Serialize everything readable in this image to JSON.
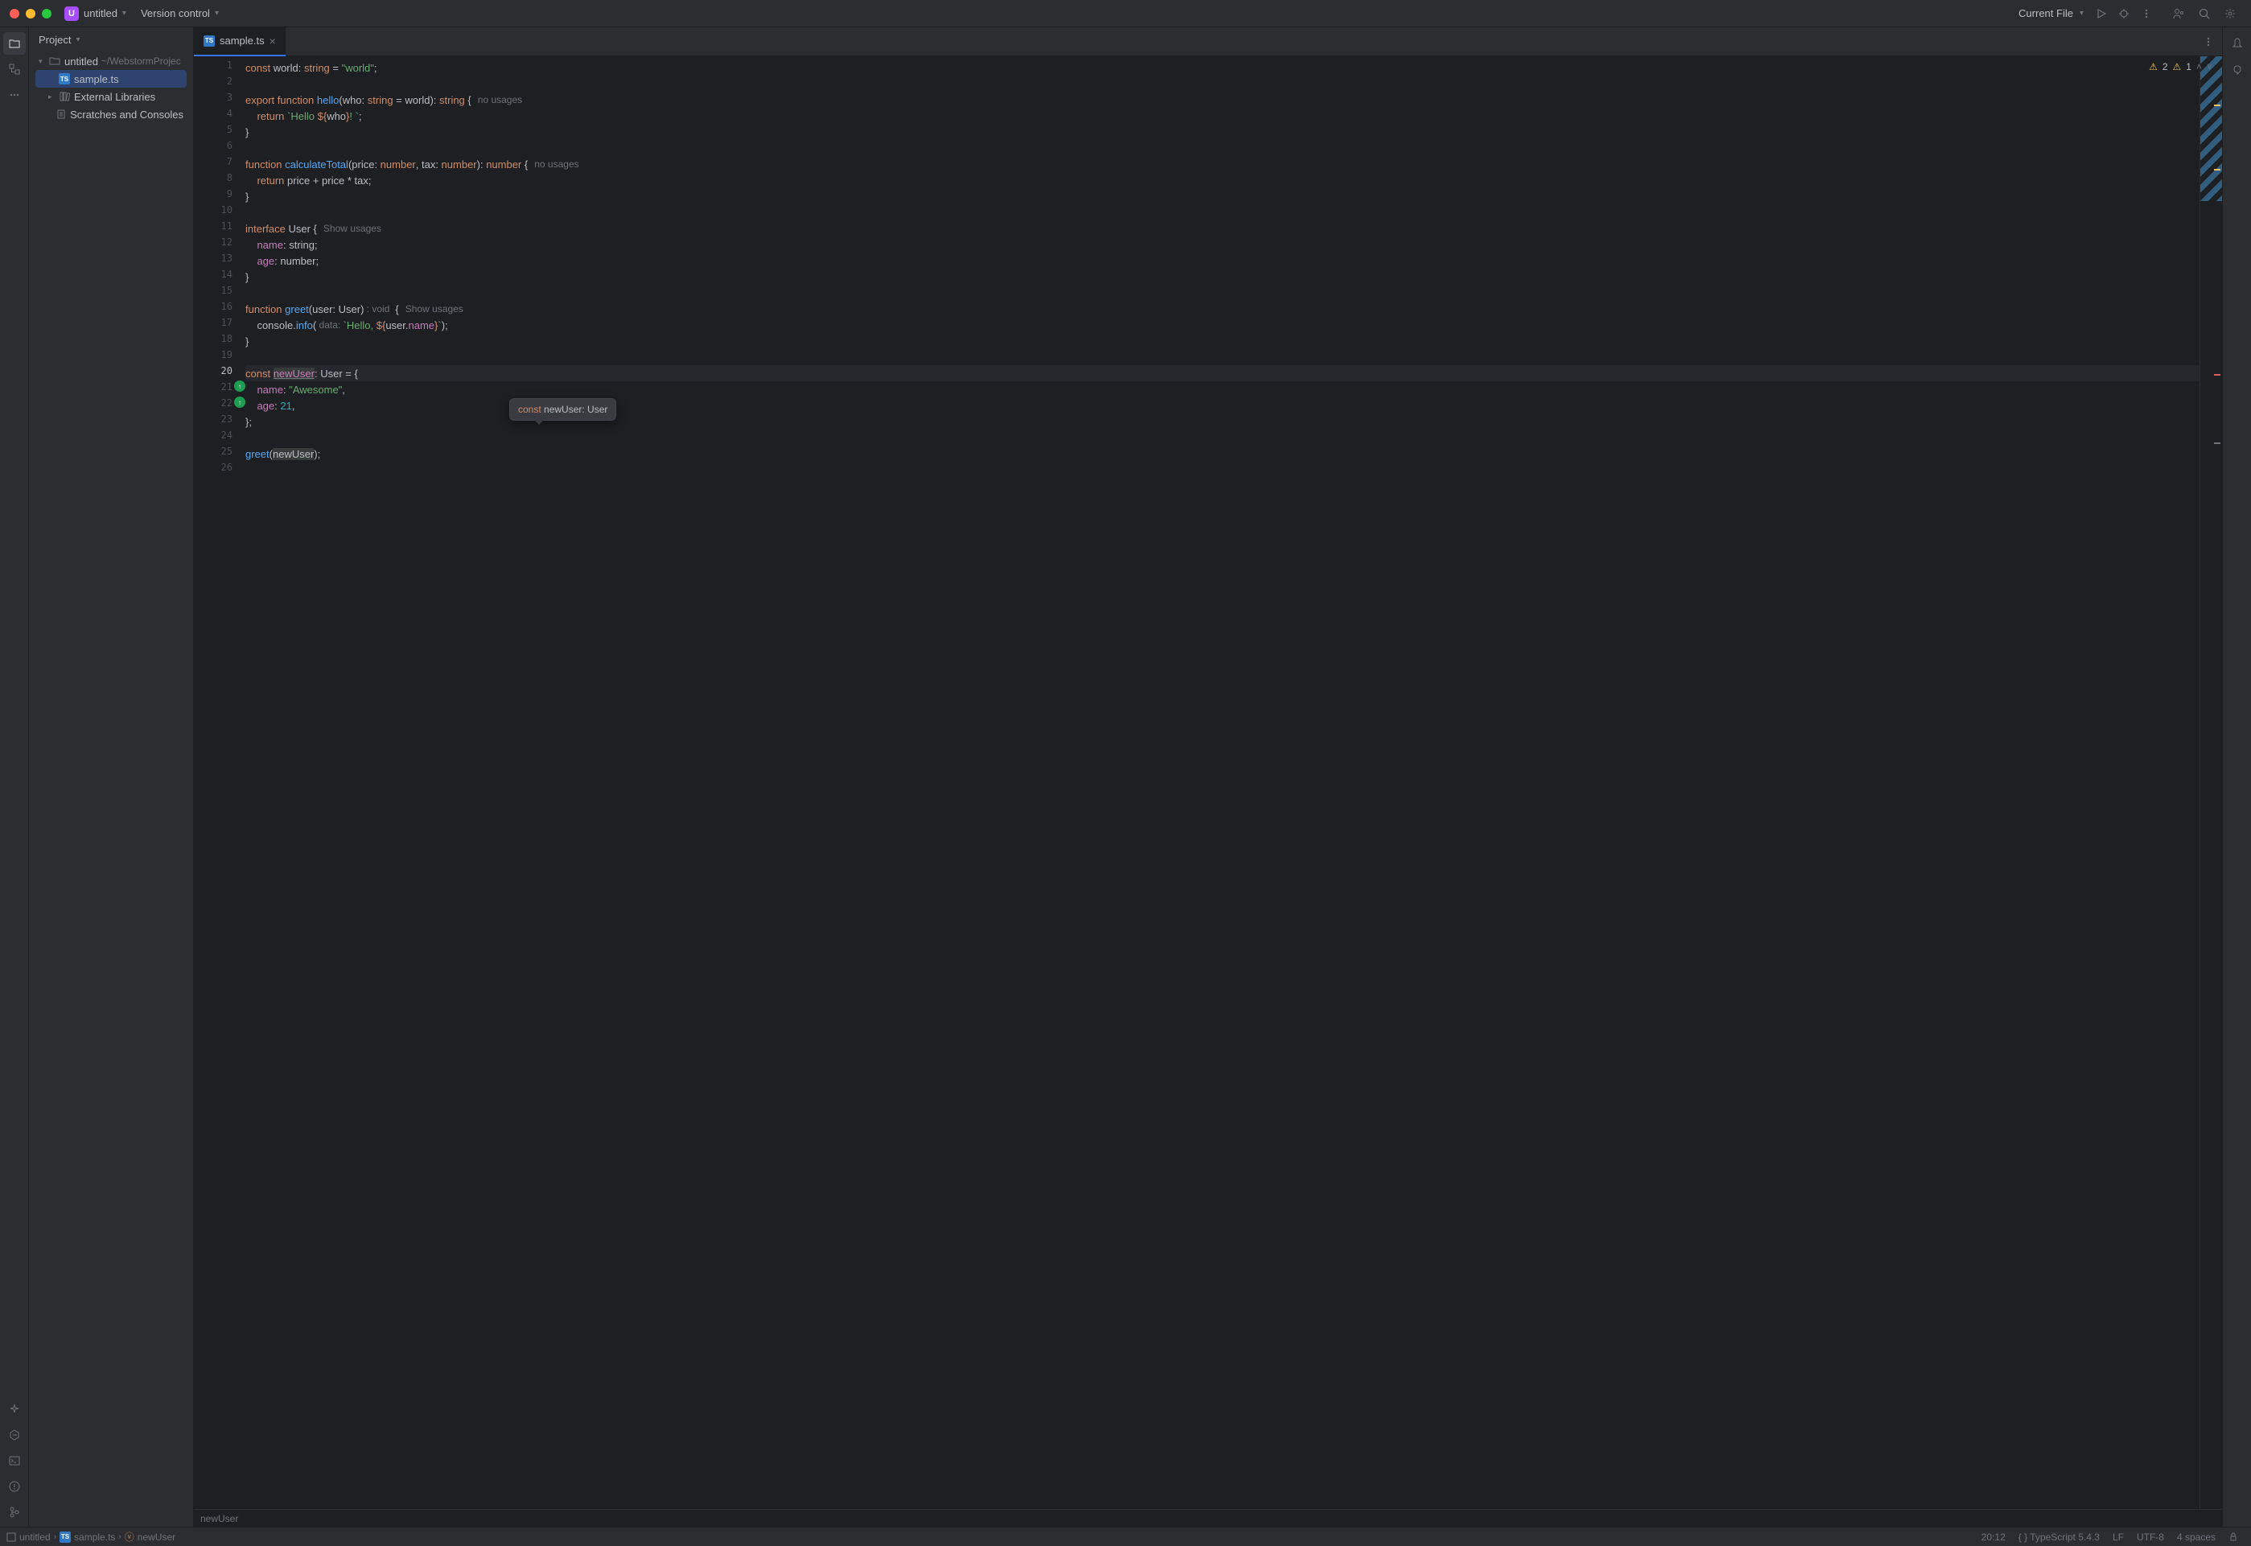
{
  "titlebar": {
    "projectBadge": "U",
    "projectName": "untitled",
    "versionControl": "Version control",
    "runConfig": "Current File"
  },
  "projectPanel": {
    "title": "Project",
    "rootName": "untitled",
    "rootPath": "~/WebstormProjec",
    "file": "sample.ts",
    "externalLibs": "External Libraries",
    "scratches": "Scratches and Consoles"
  },
  "tabs": {
    "active": "sample.ts"
  },
  "inspections": {
    "warnings": "2",
    "weakWarnings": "1"
  },
  "code": {
    "l1": {
      "kw": "const",
      "id": " world: ",
      "type": "string",
      "eq": " = ",
      "str": "\"world\"",
      "end": ";"
    },
    "l3a": {
      "kw": "export function ",
      "fn": "hello",
      "p1": "(who: ",
      "type1": "string",
      "eq": " = world): ",
      "type2": "string",
      "brace": " {",
      "hint": "no usages"
    },
    "l4": {
      "ind": "    ",
      "kw": "return ",
      "str1": "`Hello ",
      "interp": "${",
      "id": "who",
      "close": "}",
      "str2": "! `",
      "end": ";"
    },
    "l5": {
      "brace": "}"
    },
    "l7": {
      "kw": "function ",
      "fn": "calculateTotal",
      "p": "(price: ",
      "t1": "number",
      "c": ", tax: ",
      "t2": "number",
      "ret": "): ",
      "t3": "number",
      "brace": " {",
      "hint": "no usages"
    },
    "l8": {
      "ind": "    ",
      "kw": "return ",
      "expr": "price + price * tax;"
    },
    "l9": {
      "brace": "}"
    },
    "l11": {
      "kw": "interface ",
      "name": "User",
      "brace": " {",
      "hint": "Show usages"
    },
    "l12": {
      "ind": "    ",
      "prop": "name",
      "type": ": string;"
    },
    "l13": {
      "ind": "    ",
      "prop": "age",
      "type": ": number;"
    },
    "l14": {
      "brace": "}"
    },
    "l16": {
      "kw": "function ",
      "fn": "greet",
      "p": "(user: User)",
      "rethint": " : void ",
      "brace": " {",
      "hint": "Show usages"
    },
    "l17": {
      "ind": "    ",
      "obj": "console",
      "dot": ".",
      "method": "info",
      "paren": "(",
      "hint": " data: ",
      "str1": "`Hello, ",
      "interp": "${",
      "expr": "user.",
      "prop": "name",
      "close": "}",
      "str2": "`",
      "end": ");"
    },
    "l18": {
      "brace": "}"
    },
    "l20": {
      "kw": "const ",
      "id": "newUser",
      "rest": ": User = {"
    },
    "l21": {
      "ind": "    ",
      "prop": "name",
      "colon": ": ",
      "str": "\"Awesome\"",
      "comma": ","
    },
    "l22": {
      "ind": "    ",
      "prop": "age",
      "colon": ": ",
      "num": "21",
      "comma": ","
    },
    "l23": {
      "end": "};"
    },
    "l25": {
      "fn": "greet",
      "p": "(",
      "arg": "newUser",
      "end": ");"
    }
  },
  "tooltip": {
    "kw": "const ",
    "id": "newUser: ",
    "type": "User"
  },
  "breadcrumb": {
    "text": "newUser"
  },
  "statusBar": {
    "crumb1": "untitled",
    "crumb2": "sample.ts",
    "crumb3": "newUser",
    "position": "20:12",
    "lang": "TypeScript 5.4.3",
    "lineEnding": "LF",
    "encoding": "UTF-8",
    "indent": "4 spaces"
  }
}
